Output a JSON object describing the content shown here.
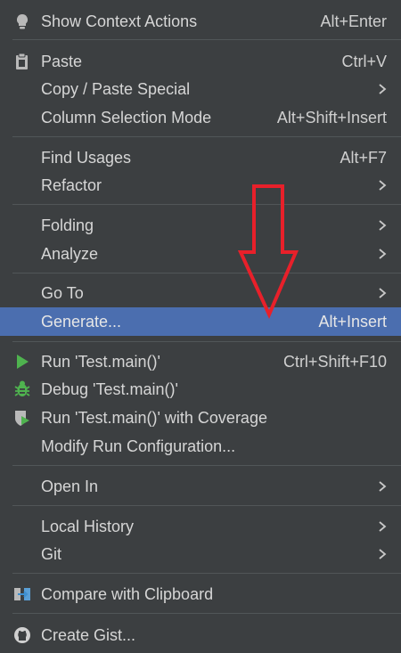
{
  "menu": {
    "items": [
      {
        "label": "Show Context Actions",
        "shortcut": "Alt+Enter",
        "icon": "lightbulb-icon"
      },
      {
        "label": "Paste",
        "shortcut": "Ctrl+V",
        "icon": "clipboard-icon"
      },
      {
        "label": "Copy / Paste Special",
        "shortcut": ""
      },
      {
        "label": "Column Selection Mode",
        "shortcut": "Alt+Shift+Insert"
      },
      {
        "label": "Find Usages",
        "shortcut": "Alt+F7"
      },
      {
        "label": "Refactor",
        "shortcut": ""
      },
      {
        "label": "Folding",
        "shortcut": ""
      },
      {
        "label": "Analyze",
        "shortcut": ""
      },
      {
        "label": "Go To",
        "shortcut": ""
      },
      {
        "label": "Generate...",
        "shortcut": "Alt+Insert",
        "selected": true
      },
      {
        "label": "Run 'Test.main()'",
        "shortcut": "Ctrl+Shift+F10",
        "icon": "run-icon"
      },
      {
        "label": "Debug 'Test.main()'",
        "shortcut": "",
        "icon": "debug-bug-icon"
      },
      {
        "label": "Run 'Test.main()' with Coverage",
        "shortcut": "",
        "icon": "coverage-shield-icon"
      },
      {
        "label": "Modify Run Configuration...",
        "shortcut": ""
      },
      {
        "label": "Open In",
        "shortcut": ""
      },
      {
        "label": "Local History",
        "shortcut": ""
      },
      {
        "label": "Git",
        "shortcut": ""
      },
      {
        "label": "Compare with Clipboard",
        "shortcut": "",
        "icon": "compare-clipboard-icon"
      },
      {
        "label": "Create Gist...",
        "shortcut": "",
        "icon": "github-icon"
      }
    ]
  },
  "colors": {
    "background": "#3c3f41",
    "selected": "#4b6eaf",
    "annotation_arrow": "#e8202a"
  }
}
